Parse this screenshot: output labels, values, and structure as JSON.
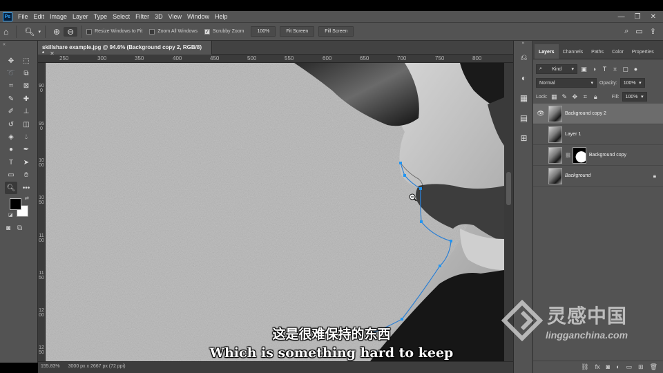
{
  "app": {
    "logo": "Ps"
  },
  "menu": [
    "File",
    "Edit",
    "Image",
    "Layer",
    "Type",
    "Select",
    "Filter",
    "3D",
    "View",
    "Window",
    "Help"
  ],
  "window_controls": [
    "minimize-icon",
    "restore-icon",
    "close-icon"
  ],
  "options": {
    "resize_windows": "Resize Windows to Fit",
    "zoom_all": "Zoom All Windows",
    "scrubby_zoom": "Scrubby Zoom",
    "zoom_pct": "100%",
    "fit_screen": "Fit Screen",
    "fill_screen": "Fill Screen"
  },
  "document": {
    "tab_title": "skillshare example.jpg @ 94.6% (Background copy 2, RGB/8) *",
    "ruler_top": [
      "250",
      "300",
      "350",
      "400",
      "450",
      "500",
      "550",
      "600",
      "650",
      "700",
      "750",
      "800"
    ],
    "ruler_left": [
      "900",
      "950",
      "1000",
      "1050",
      "1100",
      "1150",
      "1200",
      "1250"
    ],
    "status_zoom": "155.83%",
    "status_size": "3000 px x 2667 px (72 ppi)"
  },
  "layers_panel": {
    "tabs": [
      "Layers",
      "Channels",
      "Paths",
      "Color",
      "Properties"
    ],
    "kind": "Kind",
    "blend_mode": "Normal",
    "opacity_label": "Opacity:",
    "opacity": "100%",
    "lock_label": "Lock:",
    "fill_label": "Fill:",
    "fill": "100%",
    "layers": [
      {
        "name": "Background copy 2",
        "visible": true,
        "selected": true
      },
      {
        "name": "Layer 1",
        "visible": false
      },
      {
        "name": "Background copy",
        "visible": false,
        "mask": true
      },
      {
        "name": "Background",
        "visible": false,
        "locked": true
      }
    ]
  },
  "subtitles": {
    "chinese": "这是很难保持的东西",
    "english": "Which is something hard to keep"
  },
  "watermark": {
    "title": "灵感中国",
    "url": "lingganchina.com"
  },
  "colors": {
    "pen_path": "#1e88e5",
    "anchor": "#2196f3",
    "panel_bg": "#535353",
    "canvas_bg": "#b4b4b4"
  }
}
